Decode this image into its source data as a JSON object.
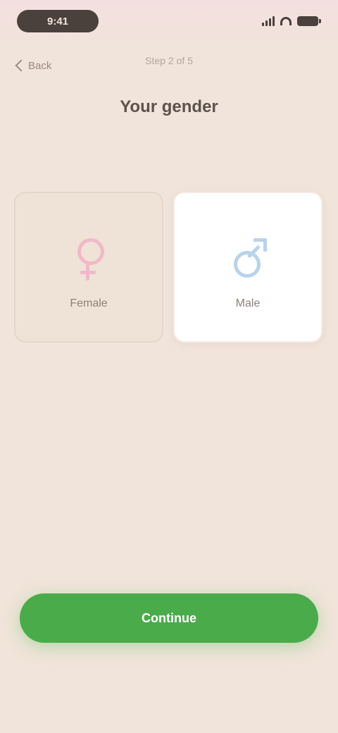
{
  "status_bar": {
    "time": "9:41"
  },
  "nav": {
    "back_label": "Back",
    "step_label": "Step 2 of 5"
  },
  "title": "Your gender",
  "options": [
    {
      "label": "Female",
      "icon": "female-symbol-icon",
      "color": "#f0b9c9",
      "selected": false
    },
    {
      "label": "Male",
      "icon": "male-symbol-icon",
      "color": "#b9d3ec",
      "selected": true
    }
  ],
  "continue_label": "Continue",
  "colors": {
    "background": "#f1e4da",
    "accent": "#4aab4a"
  }
}
